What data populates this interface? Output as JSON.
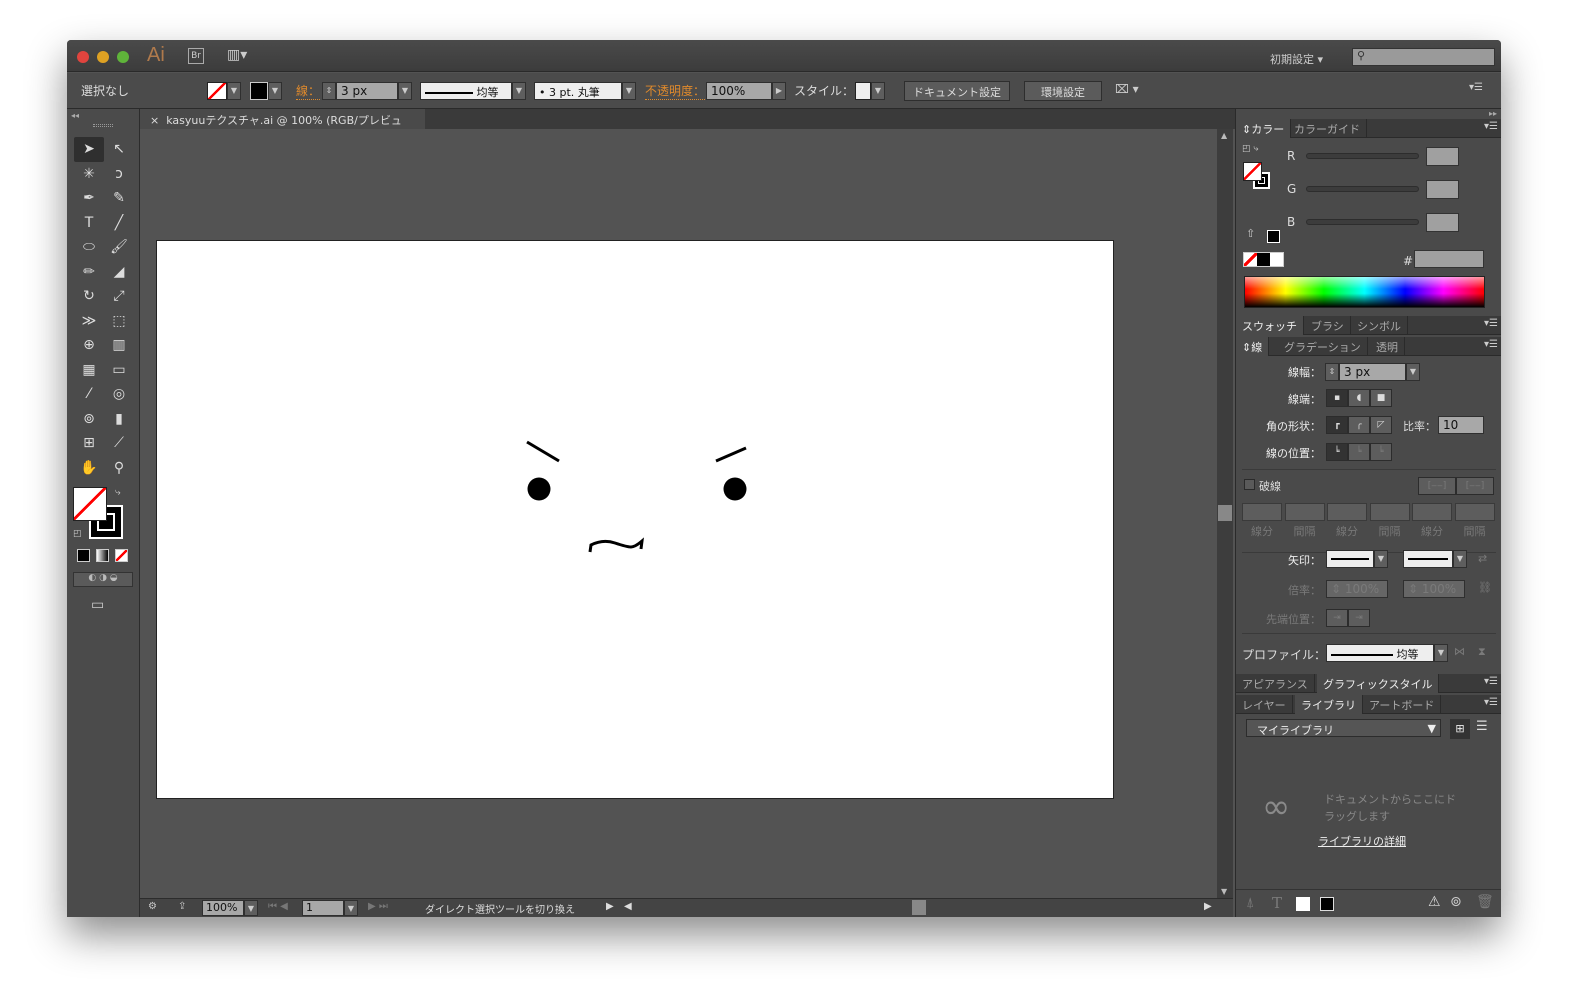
{
  "app": {
    "logo": "Ai",
    "bridge": "Br",
    "workspace": "初期設定",
    "search_placeholder": ""
  },
  "control": {
    "selection": "選択なし",
    "stroke_label": "線：",
    "stroke_value": "3 px",
    "profile": "均等",
    "brush": "3 pt. 丸筆",
    "opacity_label": "不透明度：",
    "opacity_value": "100%",
    "style_label": "スタイル：",
    "doc_setup": "ドキュメント設定",
    "prefs": "環境設定"
  },
  "document": {
    "tab_title": "kasyuuテクスチャ.ai @ 100% (RGB/プレビュー)"
  },
  "tools": [
    {
      "name": "selection-tool",
      "glyph": "➤"
    },
    {
      "name": "direct-selection-tool",
      "glyph": "↖"
    },
    {
      "name": "magic-wand-tool",
      "glyph": "✳"
    },
    {
      "name": "lasso-tool",
      "glyph": "ↄ"
    },
    {
      "name": "pen-tool",
      "glyph": "✒"
    },
    {
      "name": "curvature-tool",
      "glyph": "✎"
    },
    {
      "name": "type-tool",
      "glyph": "T"
    },
    {
      "name": "line-tool",
      "glyph": "╱"
    },
    {
      "name": "ellipse-tool",
      "glyph": "⬭"
    },
    {
      "name": "paintbrush-tool",
      "glyph": "🖌"
    },
    {
      "name": "pencil-tool",
      "glyph": "✏"
    },
    {
      "name": "eraser-tool",
      "glyph": "◢"
    },
    {
      "name": "rotate-tool",
      "glyph": "↻"
    },
    {
      "name": "scale-tool",
      "glyph": "⤢"
    },
    {
      "name": "width-tool",
      "glyph": "≫"
    },
    {
      "name": "free-transform-tool",
      "glyph": "⬚"
    },
    {
      "name": "shape-builder-tool",
      "glyph": "⊕"
    },
    {
      "name": "perspective-grid-tool",
      "glyph": "▥"
    },
    {
      "name": "mesh-tool",
      "glyph": "▦"
    },
    {
      "name": "gradient-tool",
      "glyph": "▭"
    },
    {
      "name": "eyedropper-tool",
      "glyph": "⁄"
    },
    {
      "name": "blend-tool",
      "glyph": "◎"
    },
    {
      "name": "symbol-sprayer-tool",
      "glyph": "⊚"
    },
    {
      "name": "column-graph-tool",
      "glyph": "▮"
    },
    {
      "name": "artboard-tool",
      "glyph": "⊞"
    },
    {
      "name": "slice-tool",
      "glyph": "⟋"
    },
    {
      "name": "hand-tool",
      "glyph": "✋"
    },
    {
      "name": "zoom-tool",
      "glyph": "⚲"
    }
  ],
  "color_panel": {
    "tabs": [
      "カラー",
      "カラーガイド"
    ],
    "r": "R",
    "g": "G",
    "b": "B",
    "hash": "#"
  },
  "swatch_tabs": [
    "スウォッチ",
    "ブラシ",
    "シンボル"
  ],
  "stroke_panel": {
    "tabs": [
      "線",
      "グラデーション",
      "透明"
    ],
    "weight_label": "線幅：",
    "weight": "3 px",
    "cap_label": "線端：",
    "corner_label": "角の形状：",
    "limit_label": "比率：",
    "limit": "10",
    "align_label": "線の位置：",
    "dashed": "破線",
    "dash_labels": [
      "線分",
      "間隔",
      "線分",
      "間隔",
      "線分",
      "間隔"
    ],
    "arrow_label": "矢印：",
    "scale_label": "倍率：",
    "scale1": "100%",
    "scale2": "100%",
    "tip_label": "先端位置：",
    "profile_label": "プロファイル：",
    "profile": "均等"
  },
  "appearance_tabs": [
    "アピアランス",
    "グラフィックスタイル"
  ],
  "library_tabs": [
    "レイヤー",
    "ライブラリ",
    "アートボード"
  ],
  "library": {
    "select": "マイライブラリ",
    "hint_line1": "ドキュメントからここにド",
    "hint_line2": "ラッグします",
    "link": "ライブラリの詳細"
  },
  "status": {
    "zoom": "100%",
    "artboard": "1",
    "message": "ダイレクト選択ツールを切り換え"
  },
  "colors": {
    "accent": "#e08a2c",
    "ui_bg": "#535353",
    "panel": "#4a4a4a"
  }
}
